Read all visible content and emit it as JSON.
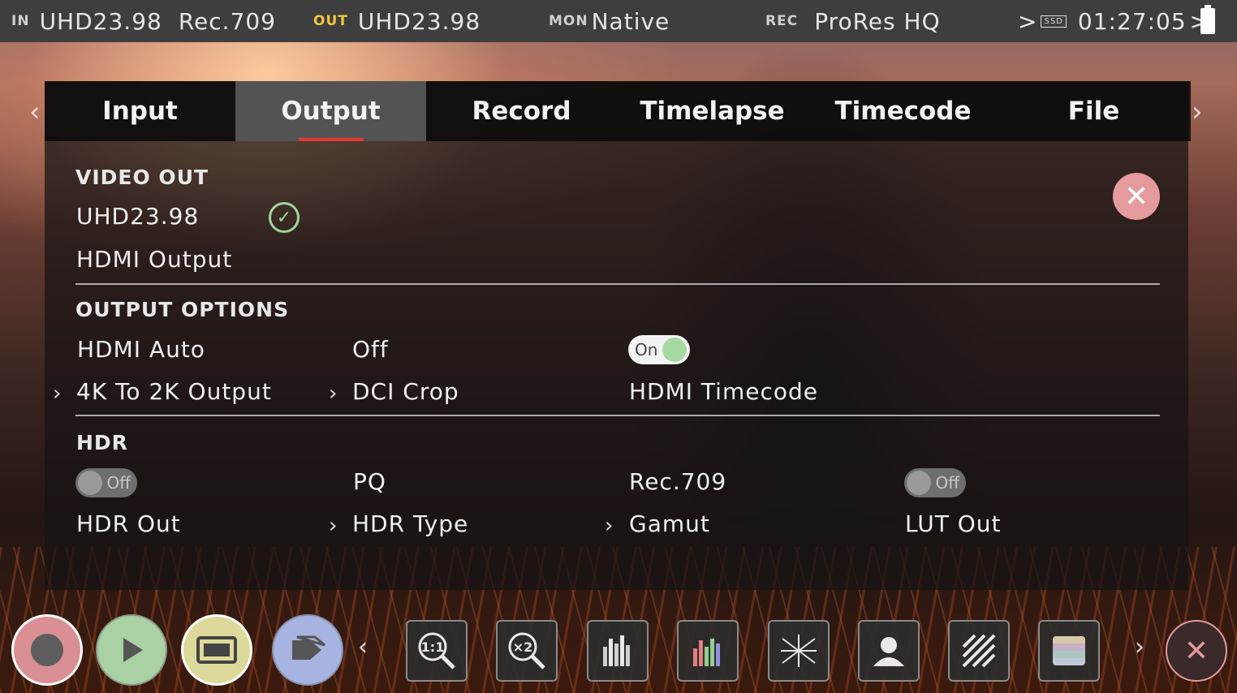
{
  "status_bar": {
    "in_tag": "IN",
    "in_format": "UHD23.98",
    "in_gamut": "Rec.709",
    "out_tag": "OUT",
    "out_format": "UHD23.98",
    "mon_tag": "MON",
    "mon_value": "Native",
    "rec_tag": "REC",
    "rec_codec": "ProRes HQ",
    "media_chevron": ">",
    "media_label": "SSD",
    "timecode": "01:27:05",
    "timecode_chevron": ">"
  },
  "tabs": [
    {
      "label": "Input",
      "active": false
    },
    {
      "label": "Output",
      "active": true
    },
    {
      "label": "Record",
      "active": false
    },
    {
      "label": "Timelapse",
      "active": false
    },
    {
      "label": "Timecode",
      "active": false
    },
    {
      "label": "File",
      "active": false
    }
  ],
  "nav": {
    "prev": "‹",
    "next": "›"
  },
  "video_out": {
    "heading": "VIDEO OUT",
    "format": "UHD23.98",
    "check_icon": "✓",
    "label": "HDMI Output"
  },
  "close_panel_icon": "✕",
  "output_options": {
    "heading": "OUTPUT OPTIONS",
    "hdmi_auto": "HDMI Auto",
    "k4_to_2k": "4K To 2K Output",
    "dci_value": "Off",
    "dci_crop": "DCI Crop",
    "hdmi_timecode_toggle": "On",
    "hdmi_timecode_on": true,
    "hdmi_timecode": "HDMI Timecode"
  },
  "hdr": {
    "heading": "HDR",
    "hdr_out_toggle": "Off",
    "hdr_out_on": false,
    "hdr_out": "HDR Out",
    "hdr_type_value": "PQ",
    "hdr_type": "HDR Type",
    "gamut_value": "Rec.709",
    "gamut": "Gamut",
    "lut_out_toggle": "Off",
    "lut_out_on": false,
    "lut_out": "LUT Out"
  },
  "chevron": "›",
  "toolbar": {
    "left_arrow": "‹",
    "right_arrow": "›",
    "zoom_1_1": "1:1",
    "zoom_x2": "×2",
    "close_icon": "✕",
    "colors": {
      "record": "#d98f93",
      "play": "#a9d1a3",
      "frame": "#ddd99a",
      "tag": "#a7b3e0"
    }
  }
}
